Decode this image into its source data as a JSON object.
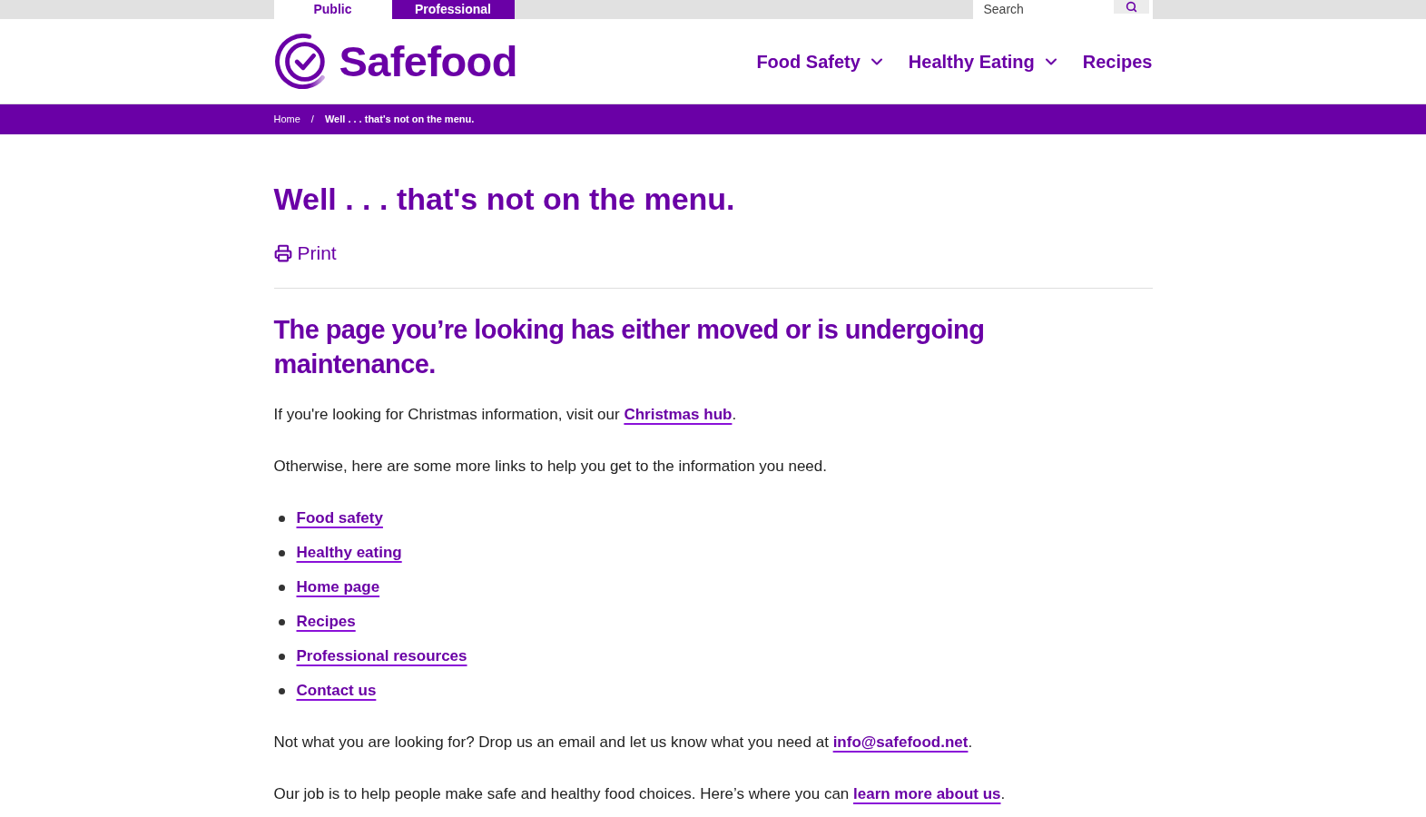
{
  "top_bar": {
    "audience_tabs": [
      {
        "label": "Public",
        "selected": true
      },
      {
        "label": "Professional",
        "selected": false
      }
    ],
    "search": {
      "placeholder": "Search"
    }
  },
  "header": {
    "logo_text": "Safefood",
    "nav": [
      {
        "label": "Food Safety",
        "kind": "dropdown"
      },
      {
        "label": "Healthy Eating",
        "kind": "dropdown"
      },
      {
        "label": "Recipes",
        "kind": "link"
      }
    ]
  },
  "breadcrumb": {
    "separator": "/",
    "items": [
      {
        "label": "Home",
        "current": false
      },
      {
        "label": "Well . . . that's not on the menu.",
        "current": true
      }
    ]
  },
  "content": {
    "title": "Well . . . that's not on the menu.",
    "print_label": "Print",
    "heading": "The page you’re looking has either moved or is undergoing maintenance.",
    "blocks": [
      {
        "kind": "paragraph",
        "segments": [
          {
            "kind": "text",
            "text": "If you're looking for Christmas information, visit our "
          },
          {
            "kind": "link",
            "text": "Christmas hub"
          },
          {
            "kind": "text",
            "text": "."
          }
        ]
      },
      {
        "kind": "paragraph",
        "segments": [
          {
            "kind": "text",
            "text": "Otherwise, here are some more links to help you get to the information you need."
          }
        ]
      },
      {
        "kind": "list",
        "items": [
          "Food safety",
          "Healthy eating",
          "Home page",
          "Recipes",
          "Professional resources",
          "Contact us"
        ]
      },
      {
        "kind": "paragraph",
        "segments": [
          {
            "kind": "text",
            "text": "Not what you are looking for? Drop us an email and let us know what you need at "
          },
          {
            "kind": "link",
            "text": "info@safefood.net"
          },
          {
            "kind": "text",
            "text": "."
          }
        ]
      },
      {
        "kind": "paragraph",
        "segments": [
          {
            "kind": "text",
            "text": "Our job is to help people make safe and healthy food choices. Here’s where you can "
          },
          {
            "kind": "link",
            "text": "learn more about us"
          },
          {
            "kind": "text",
            "text": "."
          }
        ]
      }
    ]
  }
}
